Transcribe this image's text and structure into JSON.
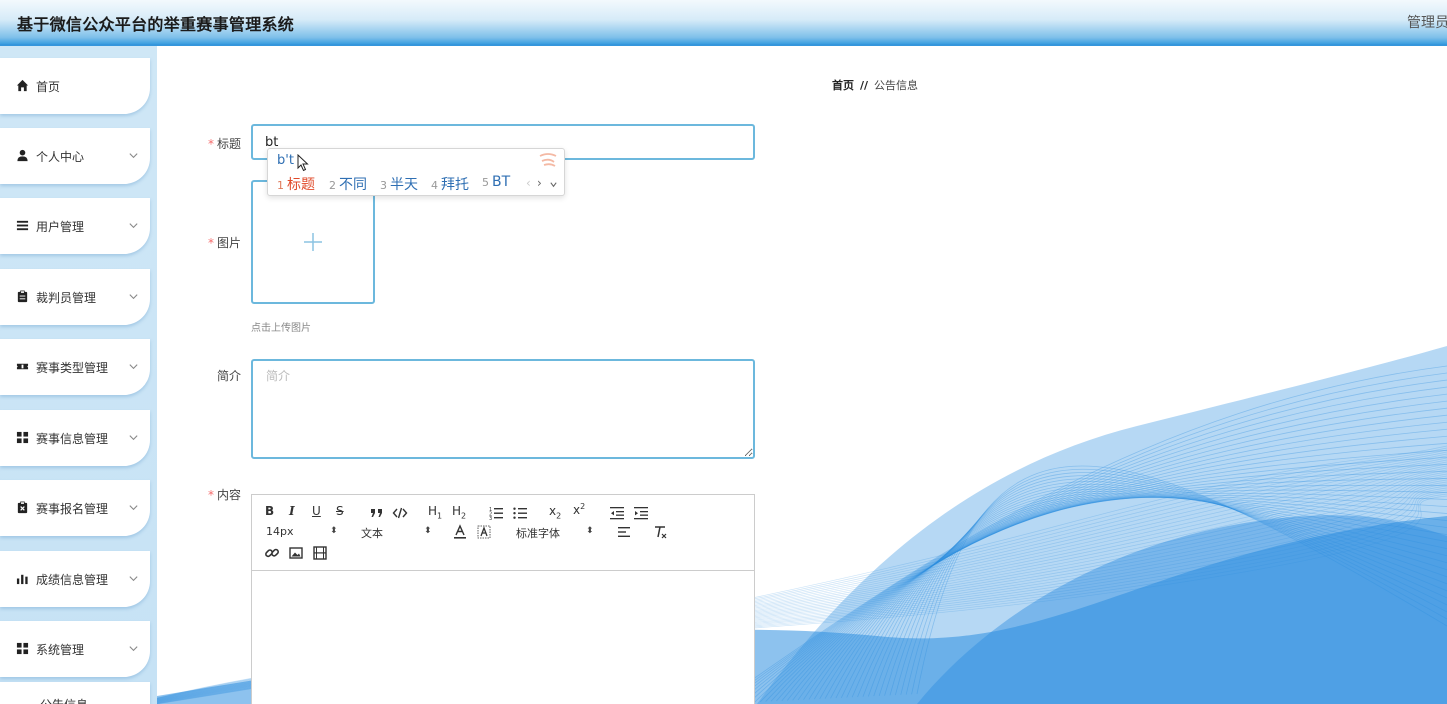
{
  "header": {
    "title": "基于微信公众平台的举重赛事管理系统",
    "user": "管理员"
  },
  "sidebar": {
    "items": [
      {
        "label": "首页",
        "icon": "home-icon",
        "has_children": false
      },
      {
        "label": "个人中心",
        "icon": "user-icon",
        "has_children": true
      },
      {
        "label": "用户管理",
        "icon": "list-icon",
        "has_children": true
      },
      {
        "label": "裁判员管理",
        "icon": "clipboard-icon",
        "has_children": true
      },
      {
        "label": "赛事类型管理",
        "icon": "ticket-icon",
        "has_children": true
      },
      {
        "label": "赛事信息管理",
        "icon": "grid-icon",
        "has_children": true
      },
      {
        "label": "赛事报名管理",
        "icon": "clipboard-x-icon",
        "has_children": true
      },
      {
        "label": "成绩信息管理",
        "icon": "bar-chart-icon",
        "has_children": true
      },
      {
        "label": "系统管理",
        "icon": "grid-icon",
        "has_children": true
      },
      {
        "label": "公告信息",
        "icon": "",
        "has_children": false
      }
    ]
  },
  "breadcrumb": {
    "home": "首页",
    "separator": "//",
    "current": "公告信息"
  },
  "form": {
    "title": {
      "label": "标题",
      "required": true,
      "value": "bt"
    },
    "image": {
      "label": "图片",
      "required": true,
      "hint": "点击上传图片"
    },
    "intro": {
      "label": "简介",
      "required": false,
      "placeholder": "简介"
    },
    "content": {
      "label": "内容",
      "required": true,
      "toolbar": {
        "font_size": "14px",
        "text_style": "文本",
        "font_family": "标准字体"
      }
    }
  },
  "ime": {
    "composition": "b't",
    "candidates": [
      {
        "n": "1",
        "text": "标题"
      },
      {
        "n": "2",
        "text": "不同"
      },
      {
        "n": "3",
        "text": "半天"
      },
      {
        "n": "4",
        "text": "拜托"
      },
      {
        "n": "5",
        "text": "BT"
      }
    ]
  },
  "colors": {
    "accent": "#3596dc",
    "input_border": "#6cb8dd",
    "required": "#f56c6c",
    "wave": "#2f8fe0"
  }
}
